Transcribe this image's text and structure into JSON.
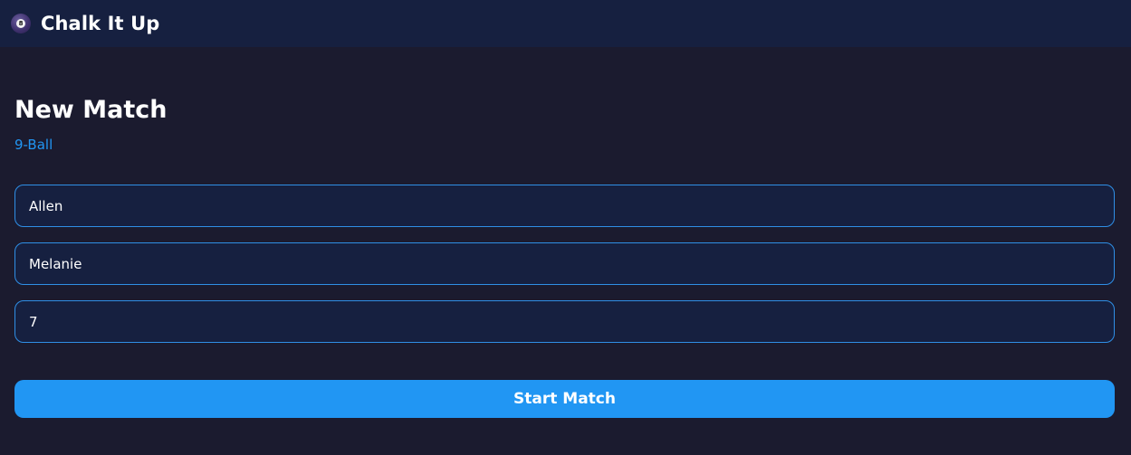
{
  "app": {
    "title": "Chalk It Up",
    "logo_icon": "eight-ball-icon",
    "logo_glyph": "8"
  },
  "match": {
    "title": "New Match",
    "game_type": "9-Ball"
  },
  "form": {
    "player1_value": "Allen",
    "player2_value": "Melanie",
    "race_to_value": "7"
  },
  "actions": {
    "start_label": "Start Match"
  },
  "colors": {
    "background": "#1b1b2f",
    "header": "#162040",
    "accent": "#2196f3",
    "field_border": "#2f8fe6"
  }
}
